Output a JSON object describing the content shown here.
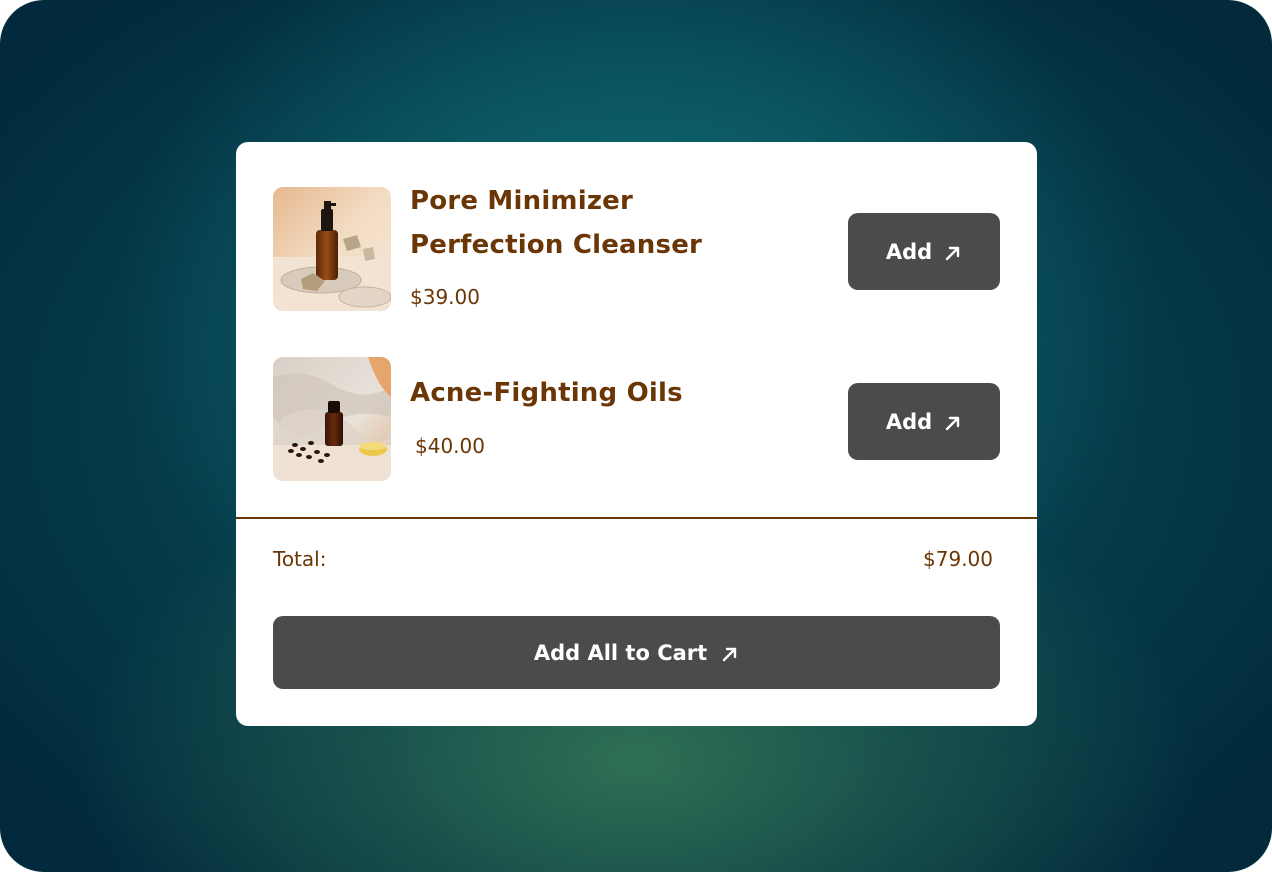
{
  "products": [
    {
      "name": "Pore Minimizer Perfection Cleanser",
      "price": "$39.00",
      "add_label": "Add",
      "image_icon": "serum-bottle-photo"
    },
    {
      "name": "Acne-Fighting Oils",
      "price": "$40.00",
      "add_label": "Add",
      "image_icon": "oil-bottle-photo"
    }
  ],
  "summary": {
    "total_label": "Total:",
    "total_value": "$79.00"
  },
  "cart_button": {
    "label": "Add All to Cart",
    "icon": "arrow-up-right-icon"
  },
  "colors": {
    "accent_text": "#6b3606",
    "button_bg": "#4b4b4b",
    "button_text": "#ffffff",
    "card_bg": "#ffffff"
  }
}
